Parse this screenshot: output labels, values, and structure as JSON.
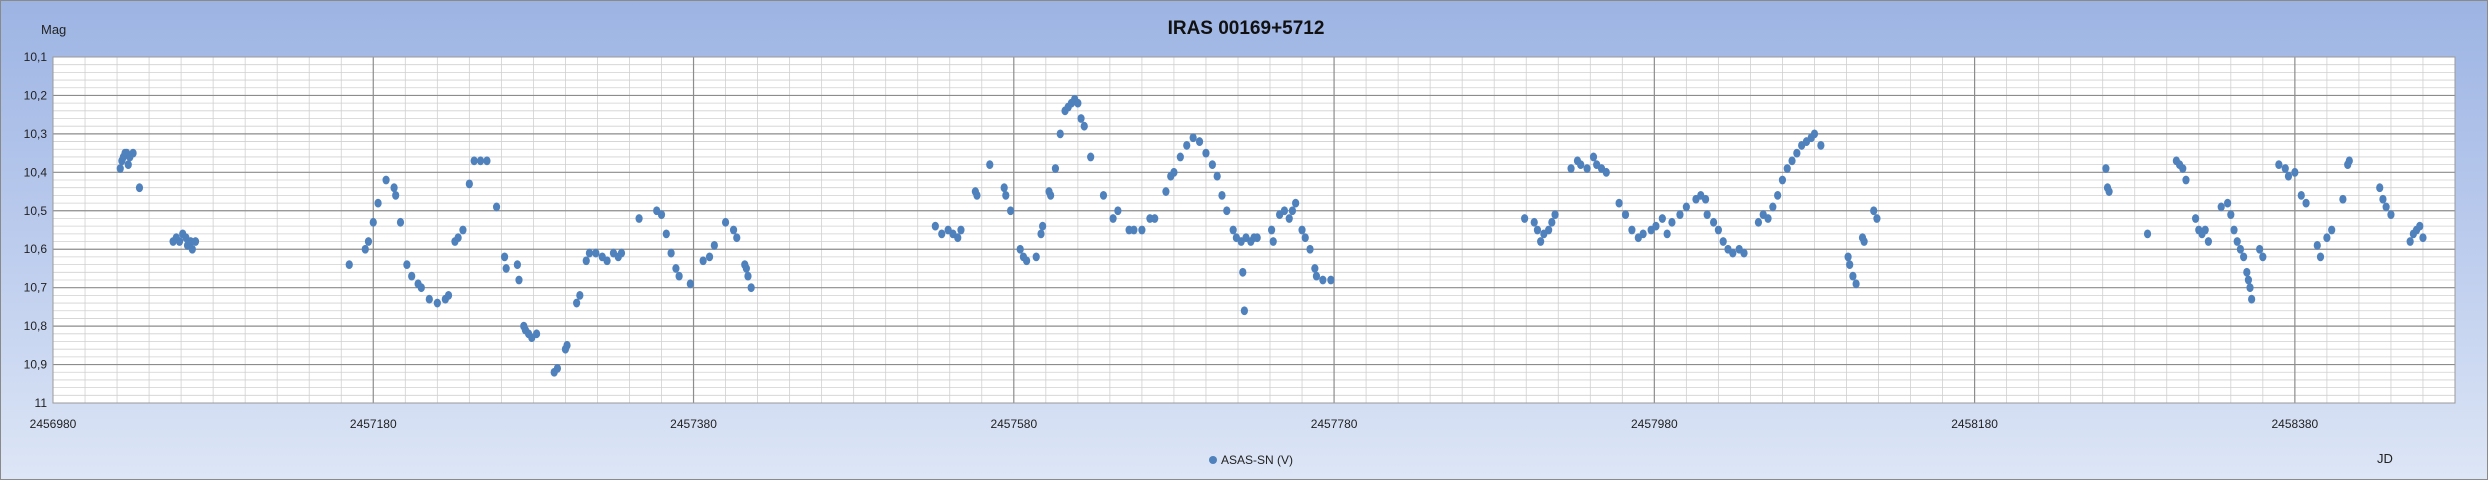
{
  "chart_data": {
    "type": "scatter",
    "title": "IRAS 00169+5712",
    "xlabel": "JD",
    "ylabel": "Mag",
    "xlim": [
      2456980,
      2458480
    ],
    "ylim": [
      11.0,
      10.1
    ],
    "y_inverted": true,
    "xticks": [
      "2456980",
      "2457180",
      "2457380",
      "2457580",
      "2457780",
      "2457980",
      "2458180",
      "2458380"
    ],
    "yticks": [
      "10,1",
      "10,2",
      "10,3",
      "10,4",
      "10,5",
      "10,6",
      "10,7",
      "10,8",
      "10,9",
      "11"
    ],
    "grid": true,
    "legend_position": "bottom",
    "series": [
      {
        "name": "ASAS-SN (V)",
        "color": "#4f81bd",
        "points": [
          [
            2457022,
            10.39
          ],
          [
            2457023,
            10.37
          ],
          [
            2457024,
            10.36
          ],
          [
            2457025,
            10.35
          ],
          [
            2457026,
            10.35
          ],
          [
            2457027,
            10.38
          ],
          [
            2457028,
            10.36
          ],
          [
            2457030,
            10.35
          ],
          [
            2457034,
            10.44
          ],
          [
            2457055,
            10.58
          ],
          [
            2457057,
            10.57
          ],
          [
            2457059,
            10.58
          ],
          [
            2457061,
            10.56
          ],
          [
            2457063,
            10.57
          ],
          [
            2457064,
            10.59
          ],
          [
            2457066,
            10.58
          ],
          [
            2457067,
            10.6
          ],
          [
            2457069,
            10.58
          ],
          [
            2457165,
            10.64
          ],
          [
            2457175,
            10.6
          ],
          [
            2457177,
            10.58
          ],
          [
            2457180,
            10.53
          ],
          [
            2457183,
            10.48
          ],
          [
            2457188,
            10.42
          ],
          [
            2457193,
            10.44
          ],
          [
            2457194,
            10.46
          ],
          [
            2457197,
            10.53
          ],
          [
            2457201,
            10.64
          ],
          [
            2457204,
            10.67
          ],
          [
            2457208,
            10.69
          ],
          [
            2457210,
            10.7
          ],
          [
            2457215,
            10.73
          ],
          [
            2457220,
            10.74
          ],
          [
            2457225,
            10.73
          ],
          [
            2457227,
            10.72
          ],
          [
            2457231,
            10.58
          ],
          [
            2457233,
            10.57
          ],
          [
            2457236,
            10.55
          ],
          [
            2457240,
            10.43
          ],
          [
            2457243,
            10.37
          ],
          [
            2457247,
            10.37
          ],
          [
            2457251,
            10.37
          ],
          [
            2457257,
            10.49
          ],
          [
            2457262,
            10.62
          ],
          [
            2457263,
            10.65
          ],
          [
            2457270,
            10.64
          ],
          [
            2457271,
            10.68
          ],
          [
            2457274,
            10.8
          ],
          [
            2457275,
            10.81
          ],
          [
            2457277,
            10.82
          ],
          [
            2457279,
            10.83
          ],
          [
            2457282,
            10.82
          ],
          [
            2457293,
            10.92
          ],
          [
            2457295,
            10.91
          ],
          [
            2457300,
            10.86
          ],
          [
            2457301,
            10.85
          ],
          [
            2457307,
            10.74
          ],
          [
            2457309,
            10.72
          ],
          [
            2457313,
            10.63
          ],
          [
            2457315,
            10.61
          ],
          [
            2457319,
            10.61
          ],
          [
            2457323,
            10.62
          ],
          [
            2457326,
            10.63
          ],
          [
            2457330,
            10.61
          ],
          [
            2457333,
            10.62
          ],
          [
            2457335,
            10.61
          ],
          [
            2457346,
            10.52
          ],
          [
            2457357,
            10.5
          ],
          [
            2457360,
            10.51
          ],
          [
            2457363,
            10.56
          ],
          [
            2457366,
            10.61
          ],
          [
            2457369,
            10.65
          ],
          [
            2457371,
            10.67
          ],
          [
            2457378,
            10.69
          ],
          [
            2457386,
            10.63
          ],
          [
            2457390,
            10.62
          ],
          [
            2457393,
            10.59
          ],
          [
            2457400,
            10.53
          ],
          [
            2457405,
            10.55
          ],
          [
            2457407,
            10.57
          ],
          [
            2457412,
            10.64
          ],
          [
            2457413,
            10.65
          ],
          [
            2457414,
            10.67
          ],
          [
            2457416,
            10.7
          ],
          [
            2457531,
            10.54
          ],
          [
            2457535,
            10.56
          ],
          [
            2457539,
            10.55
          ],
          [
            2457542,
            10.56
          ],
          [
            2457545,
            10.57
          ],
          [
            2457547,
            10.55
          ],
          [
            2457556,
            10.45
          ],
          [
            2457557,
            10.46
          ],
          [
            2457565,
            10.38
          ],
          [
            2457574,
            10.44
          ],
          [
            2457575,
            10.46
          ],
          [
            2457578,
            10.5
          ],
          [
            2457584,
            10.6
          ],
          [
            2457586,
            10.62
          ],
          [
            2457588,
            10.63
          ],
          [
            2457594,
            10.62
          ],
          [
            2457597,
            10.56
          ],
          [
            2457598,
            10.54
          ],
          [
            2457602,
            10.45
          ],
          [
            2457603,
            10.46
          ],
          [
            2457606,
            10.39
          ],
          [
            2457609,
            10.3
          ],
          [
            2457612,
            10.24
          ],
          [
            2457614,
            10.23
          ],
          [
            2457616,
            10.22
          ],
          [
            2457618,
            10.21
          ],
          [
            2457620,
            10.22
          ],
          [
            2457622,
            10.26
          ],
          [
            2457624,
            10.28
          ],
          [
            2457628,
            10.36
          ],
          [
            2457636,
            10.46
          ],
          [
            2457642,
            10.52
          ],
          [
            2457645,
            10.5
          ],
          [
            2457652,
            10.55
          ],
          [
            2457655,
            10.55
          ],
          [
            2457660,
            10.55
          ],
          [
            2457665,
            10.52
          ],
          [
            2457668,
            10.52
          ],
          [
            2457675,
            10.45
          ],
          [
            2457678,
            10.41
          ],
          [
            2457680,
            10.4
          ],
          [
            2457684,
            10.36
          ],
          [
            2457688,
            10.33
          ],
          [
            2457692,
            10.31
          ],
          [
            2457696,
            10.32
          ],
          [
            2457700,
            10.35
          ],
          [
            2457704,
            10.38
          ],
          [
            2457707,
            10.41
          ],
          [
            2457710,
            10.46
          ],
          [
            2457713,
            10.5
          ],
          [
            2457717,
            10.55
          ],
          [
            2457719,
            10.57
          ],
          [
            2457722,
            10.58
          ],
          [
            2457725,
            10.57
          ],
          [
            2457728,
            10.58
          ],
          [
            2457730,
            10.57
          ],
          [
            2457732,
            10.57
          ],
          [
            2457723,
            10.66
          ],
          [
            2457724,
            10.76
          ],
          [
            2457741,
            10.55
          ],
          [
            2457742,
            10.58
          ],
          [
            2457746,
            10.51
          ],
          [
            2457749,
            10.5
          ],
          [
            2457752,
            10.52
          ],
          [
            2457754,
            10.5
          ],
          [
            2457756,
            10.48
          ],
          [
            2457760,
            10.55
          ],
          [
            2457762,
            10.57
          ],
          [
            2457765,
            10.6
          ],
          [
            2457768,
            10.65
          ],
          [
            2457769,
            10.67
          ],
          [
            2457773,
            10.68
          ],
          [
            2457778,
            10.68
          ],
          [
            2457899,
            10.52
          ],
          [
            2457905,
            10.53
          ],
          [
            2457907,
            10.55
          ],
          [
            2457909,
            10.58
          ],
          [
            2457911,
            10.56
          ],
          [
            2457914,
            10.55
          ],
          [
            2457916,
            10.53
          ],
          [
            2457918,
            10.51
          ],
          [
            2457928,
            10.39
          ],
          [
            2457932,
            10.37
          ],
          [
            2457934,
            10.38
          ],
          [
            2457938,
            10.39
          ],
          [
            2457942,
            10.36
          ],
          [
            2457944,
            10.38
          ],
          [
            2457947,
            10.39
          ],
          [
            2457950,
            10.4
          ],
          [
            2457958,
            10.48
          ],
          [
            2457962,
            10.51
          ],
          [
            2457966,
            10.55
          ],
          [
            2457970,
            10.57
          ],
          [
            2457973,
            10.56
          ],
          [
            2457978,
            10.55
          ],
          [
            2457981,
            10.54
          ],
          [
            2457985,
            10.52
          ],
          [
            2457988,
            10.56
          ],
          [
            2457991,
            10.53
          ],
          [
            2457996,
            10.51
          ],
          [
            2458000,
            10.49
          ],
          [
            2458006,
            10.47
          ],
          [
            2458009,
            10.46
          ],
          [
            2458012,
            10.47
          ],
          [
            2458013,
            10.51
          ],
          [
            2458017,
            10.53
          ],
          [
            2458020,
            10.55
          ],
          [
            2458023,
            10.58
          ],
          [
            2458026,
            10.6
          ],
          [
            2458029,
            10.61
          ],
          [
            2458033,
            10.6
          ],
          [
            2458036,
            10.61
          ],
          [
            2458045,
            10.53
          ],
          [
            2458048,
            10.51
          ],
          [
            2458051,
            10.52
          ],
          [
            2458054,
            10.49
          ],
          [
            2458057,
            10.46
          ],
          [
            2458060,
            10.42
          ],
          [
            2458063,
            10.39
          ],
          [
            2458066,
            10.37
          ],
          [
            2458069,
            10.35
          ],
          [
            2458072,
            10.33
          ],
          [
            2458075,
            10.32
          ],
          [
            2458078,
            10.31
          ],
          [
            2458080,
            10.3
          ],
          [
            2458084,
            10.33
          ],
          [
            2458101,
            10.62
          ],
          [
            2458102,
            10.64
          ],
          [
            2458104,
            10.67
          ],
          [
            2458106,
            10.69
          ],
          [
            2458110,
            10.57
          ],
          [
            2458111,
            10.58
          ],
          [
            2458117,
            10.5
          ],
          [
            2458119,
            10.52
          ],
          [
            2458262,
            10.39
          ],
          [
            2458263,
            10.44
          ],
          [
            2458264,
            10.45
          ],
          [
            2458288,
            10.56
          ],
          [
            2458306,
            10.37
          ],
          [
            2458308,
            10.38
          ],
          [
            2458310,
            10.39
          ],
          [
            2458312,
            10.42
          ],
          [
            2458318,
            10.52
          ],
          [
            2458320,
            10.55
          ],
          [
            2458322,
            10.56
          ],
          [
            2458324,
            10.55
          ],
          [
            2458326,
            10.58
          ],
          [
            2458334,
            10.49
          ],
          [
            2458338,
            10.48
          ],
          [
            2458340,
            10.51
          ],
          [
            2458342,
            10.55
          ],
          [
            2458344,
            10.58
          ],
          [
            2458346,
            10.6
          ],
          [
            2458348,
            10.62
          ],
          [
            2458350,
            10.66
          ],
          [
            2458351,
            10.68
          ],
          [
            2458352,
            10.7
          ],
          [
            2458353,
            10.73
          ],
          [
            2458358,
            10.6
          ],
          [
            2458360,
            10.62
          ],
          [
            2458370,
            10.38
          ],
          [
            2458374,
            10.39
          ],
          [
            2458376,
            10.41
          ],
          [
            2458380,
            10.4
          ],
          [
            2458384,
            10.46
          ],
          [
            2458387,
            10.48
          ],
          [
            2458394,
            10.59
          ],
          [
            2458396,
            10.62
          ],
          [
            2458400,
            10.57
          ],
          [
            2458403,
            10.55
          ],
          [
            2458410,
            10.47
          ],
          [
            2458413,
            10.38
          ],
          [
            2458414,
            10.37
          ],
          [
            2458433,
            10.44
          ],
          [
            2458435,
            10.47
          ],
          [
            2458437,
            10.49
          ],
          [
            2458440,
            10.51
          ],
          [
            2458452,
            10.58
          ],
          [
            2458454,
            10.56
          ],
          [
            2458456,
            10.55
          ],
          [
            2458458,
            10.54
          ],
          [
            2458460,
            10.57
          ]
        ]
      }
    ]
  }
}
